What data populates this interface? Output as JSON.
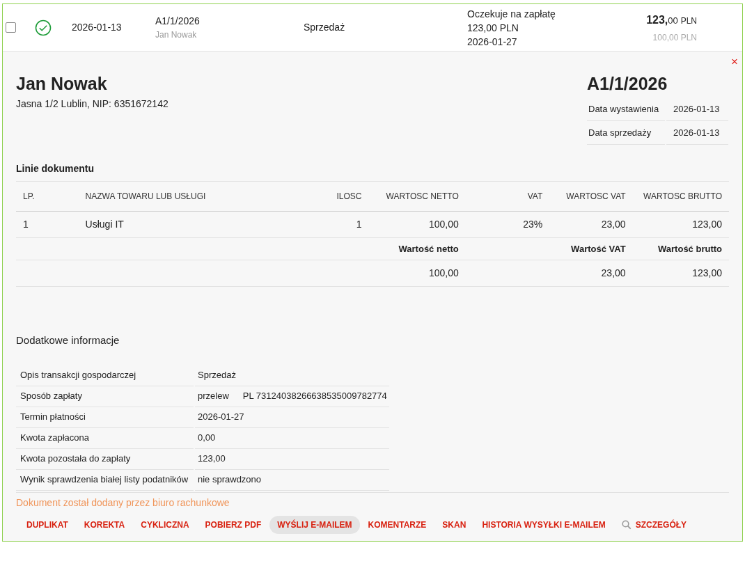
{
  "row": {
    "checked": false,
    "approved": true,
    "date": "2026-01-13",
    "number": "A1/1/2026",
    "contractor": "Jan Nowak",
    "type": "Sprzedaż",
    "status_lines": [
      "Oczekuje na zapłatę",
      "123,00 PLN",
      "2026-01-27"
    ],
    "amount_whole": "123,",
    "amount_fraction": "00",
    "amount_currency": "PLN",
    "amount_net": "100,00 PLN"
  },
  "detail": {
    "close": "×",
    "buyer_name": "Jan Nowak",
    "buyer_address": "Jasna 1/2 Lublin, NIP: 6351672142",
    "doc_number": "A1/1/2026",
    "dates": [
      {
        "label": "Data wystawienia",
        "value": "2026-01-13"
      },
      {
        "label": "Data sprzedaży",
        "value": "2026-01-13"
      }
    ],
    "lines_title": "Linie dokumentu",
    "columns": [
      "LP.",
      "NAZWA TOWARU LUB USŁUGI",
      "ILOSC",
      "WARTOSC NETTO",
      "VAT",
      "WARTOSC VAT",
      "WARTOSC BRUTTO"
    ],
    "rows": [
      [
        "1",
        "Usługi IT",
        "1",
        "100,00",
        "23%",
        "23,00",
        "123,00"
      ]
    ],
    "totals": [
      {
        "label": "Wartość netto",
        "value": "100,00"
      },
      {
        "label": "Wartość VAT",
        "value": "23,00"
      },
      {
        "label": "Wartość brutto",
        "value": "123,00"
      }
    ],
    "info_title": "Dodatkowe informacje",
    "info": [
      {
        "label": "Opis transakcji gospodarczej",
        "values": [
          "Sprzedaż"
        ]
      },
      {
        "label": "Sposób zapłaty",
        "values": [
          "przelew",
          "PL 73124038266638535009782774"
        ]
      },
      {
        "label": "Termin płatności",
        "values": [
          "2026-01-27"
        ]
      },
      {
        "label": "Kwota zapłacona",
        "values": [
          "0,00"
        ]
      },
      {
        "label": "Kwota pozostała do zapłaty",
        "values": [
          "123,00"
        ]
      },
      {
        "label": "Wynik sprawdzenia białej listy podatników",
        "values": [
          "nie sprawdzono"
        ]
      }
    ],
    "note": "Dokument został dodany przez biuro rachunkowe",
    "actions": [
      {
        "label": "DUPLIKAT",
        "selected": false
      },
      {
        "label": "KOREKTA",
        "selected": false
      },
      {
        "label": "CYKLICZNA",
        "selected": false
      },
      {
        "label": "POBIERZ PDF",
        "selected": false
      },
      {
        "label": "WYŚLIJ E-MAILEM",
        "selected": true
      },
      {
        "label": "KOMENTARZE",
        "selected": false
      },
      {
        "label": "SKAN",
        "selected": false
      },
      {
        "label": "HISTORIA WYSYŁKI E-MAILEM",
        "selected": false
      },
      {
        "label": "SZCZEGÓŁY",
        "selected": false,
        "kind": "search"
      }
    ]
  }
}
